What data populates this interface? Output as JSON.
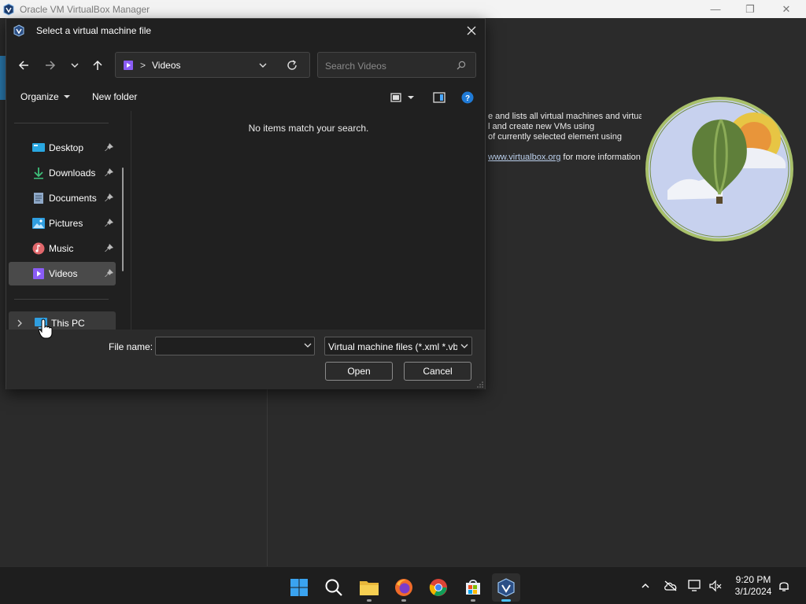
{
  "main_window": {
    "title": "Oracle VM VirtualBox Manager",
    "controls": {
      "minimize": "—",
      "maximize": "❐",
      "close": "✕"
    },
    "welcome": {
      "line1": "e and lists all virtual machines and virtual",
      "line2": "l and create new VMs using",
      "line3": "of currently selected element using",
      "link": "www.virtualbox.org",
      "link_suffix": " for more information"
    }
  },
  "dialog": {
    "title": "Select a virtual machine file",
    "address": {
      "location": "Videos",
      "separator": ">"
    },
    "search": {
      "placeholder": "Search Videos"
    },
    "toolbar": {
      "organize": "Organize",
      "new_folder": "New folder"
    },
    "sidebar": {
      "items": [
        {
          "label": "Desktop",
          "icon": "desktop-icon",
          "color": "#29a7e1"
        },
        {
          "label": "Downloads",
          "icon": "download-icon",
          "color": "#3ec07a"
        },
        {
          "label": "Documents",
          "icon": "document-icon",
          "color": "#8fa9c8"
        },
        {
          "label": "Pictures",
          "icon": "pictures-icon",
          "color": "#2f9ee0"
        },
        {
          "label": "Music",
          "icon": "music-icon",
          "color": "#e0676b"
        },
        {
          "label": "Videos",
          "icon": "videos-icon",
          "color": "#8a5cf6",
          "selected": true
        }
      ],
      "this_pc": "This PC"
    },
    "content": {
      "empty_message": "No items match your search."
    },
    "footer": {
      "file_name_label": "File name:",
      "file_name_value": "",
      "filter": "Virtual machine files (*.xml *.vb",
      "open": "Open",
      "cancel": "Cancel"
    }
  },
  "taskbar": {
    "apps": [
      {
        "name": "start",
        "icon": "windows-icon"
      },
      {
        "name": "search",
        "icon": "search-icon"
      },
      {
        "name": "file-explorer",
        "icon": "folder-icon",
        "running": true
      },
      {
        "name": "firefox",
        "icon": "firefox-icon",
        "running": true
      },
      {
        "name": "chrome",
        "icon": "chrome-icon"
      },
      {
        "name": "store",
        "icon": "store-icon",
        "running": true
      },
      {
        "name": "virtualbox",
        "icon": "virtualbox-icon",
        "active": true
      }
    ],
    "time": "9:20 PM",
    "date": "3/1/2024"
  }
}
